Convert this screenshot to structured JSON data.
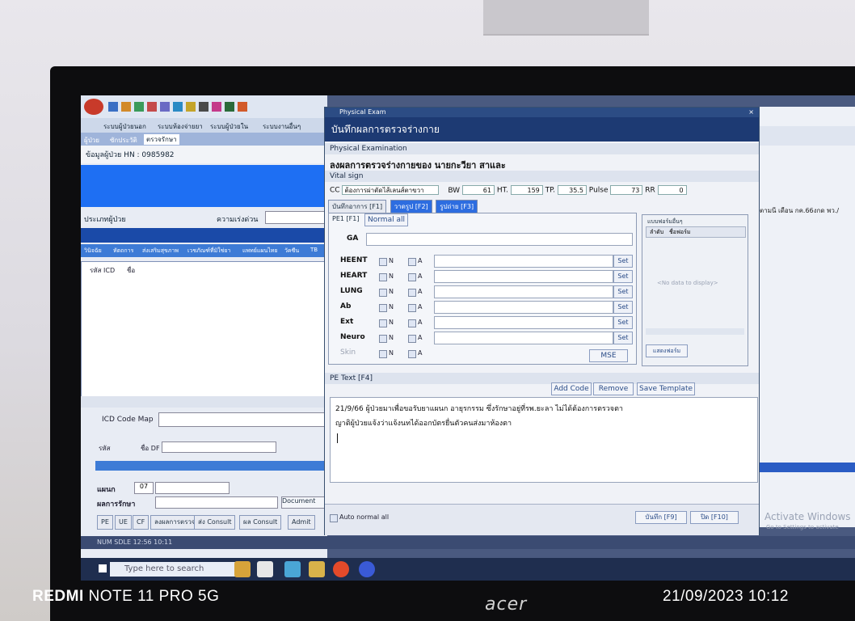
{
  "photo_watermark": {
    "model_bold": "REDMI",
    "model_rest": " NOTE 11 PRO 5G",
    "datetime": "21/09/2023  10:12"
  },
  "monitor_brand": "acer",
  "background_app": {
    "menu_items": [
      "ระบบผู้ป่วยนอก",
      "ระบบห้องจ่ายยา",
      "ระบบผู้ป่วยใน",
      "ระบบงานอื่นๆ"
    ],
    "tabs": [
      "ผู้ป่วย",
      "ซักประวัติ",
      "ตรวจรักษา"
    ],
    "hn_label": "ข้อมูลผู้ป่วย HN : 0985982",
    "patient_type_label": "ประเภทผู้ป่วย",
    "urgency_label": "ความเร่งด่วน",
    "lower_tabs": [
      "วินิจฉัย",
      "หัตถการ",
      "ส่งเสริมสุขภาพ",
      "เวชภัณฑ์ที่มิใช่ยา",
      "แพทย์แผนไทย",
      "วัคซีน",
      "TB"
    ],
    "grid_headers": [
      "รหัส ICD",
      "ชื่อ"
    ],
    "icd_code_map": "ICD Code Map",
    "df_label": "ชื่อ DF",
    "code_label": "รหัส",
    "plan_label": "แผนก",
    "plan_code": "07",
    "treat_label": "ผลการรักษา",
    "bottom_buttons": [
      "PE",
      "UE",
      "CF",
      "ลงผลการตรวจ",
      "ส่ง Consult",
      "ผล Consult",
      "Admit"
    ],
    "document_label": "Document",
    "status_text": "NUM   SDLE 12:56   10:11",
    "search_placeholder": "Type here to search",
    "right_note": "ตามนี เดือน กค.66งกด พว./",
    "activate_windows": "Activate Windows",
    "activate_windows_sub": "Go to Settings to activate"
  },
  "dialog": {
    "window_title": "Physical Exam",
    "header": "บันทึกผลการตรวจร่างกาย",
    "section_exam": "Physical Examination",
    "patient_name_line": "ลงผลการตรวจร่างกายของ  นายกะวียา  สาและ",
    "section_vital": "Vital sign",
    "vital": {
      "cc_label": "CC",
      "cc_value": "ต้องการผ่าตัดไส้เลนส์ตาขวา",
      "bw_label": "BW",
      "bw_value": "61",
      "ht_label": "HT.",
      "ht_value": "159",
      "tp_label": "TP.",
      "tp_value": "35.5",
      "pulse_label": "Pulse",
      "pulse_value": "73",
      "rr_label": "RR",
      "rr_value": "0"
    },
    "tabs": [
      "บันทึกอาการ [F1]",
      "วาดรูป [F2]",
      "รูปถ่าย [F3]"
    ],
    "pe_tab": "PE1 [F1]",
    "normal_all": "Normal all",
    "ga_label": "GA",
    "rows": [
      {
        "label": "HEENT",
        "n": "N",
        "a": "A",
        "set": "Set"
      },
      {
        "label": "HEART",
        "n": "N",
        "a": "A",
        "set": "Set"
      },
      {
        "label": "LUNG",
        "n": "N",
        "a": "A",
        "set": "Set"
      },
      {
        "label": "Ab",
        "n": "N",
        "a": "A",
        "set": "Set"
      },
      {
        "label": "Ext",
        "n": "N",
        "a": "A",
        "set": "Set"
      },
      {
        "label": "Neuro",
        "n": "N",
        "a": "A",
        "set": "Set"
      },
      {
        "label": "Skin",
        "n": "N",
        "a": "A",
        "set": ""
      }
    ],
    "mse_button": "MSE",
    "side_panel_title": "แบบฟอร์มอื่นๆ",
    "side_headers": [
      "ลำดับ",
      "ชื่อฟอร์ม"
    ],
    "side_empty": "<No data to display>",
    "side_button": "แสดงฟอร์ม",
    "pe_text_section": "PE Text [F4]",
    "add_code": "Add Code",
    "remove": "Remove",
    "save_template": "Save Template",
    "pe_text_line1": "21/9/66 ผู้ป่วยมาเพื่อขอรับยาแผนก อายุรกรรม ซึ่งรักษาอยู่ที่รพ.ยะลา ไม่ได้ต้องการตรวจตา",
    "pe_text_line2": "ญาติผู้ป่วยแจ้งว่าแจ้งนทได้ออกบัตรยื่นตัวคนส่งมาห้องตา",
    "auto_normal": "Auto normal all",
    "save_button": "บันทึก [F9]",
    "close_button": "ปิด [F10]",
    "close_icon": "×"
  }
}
